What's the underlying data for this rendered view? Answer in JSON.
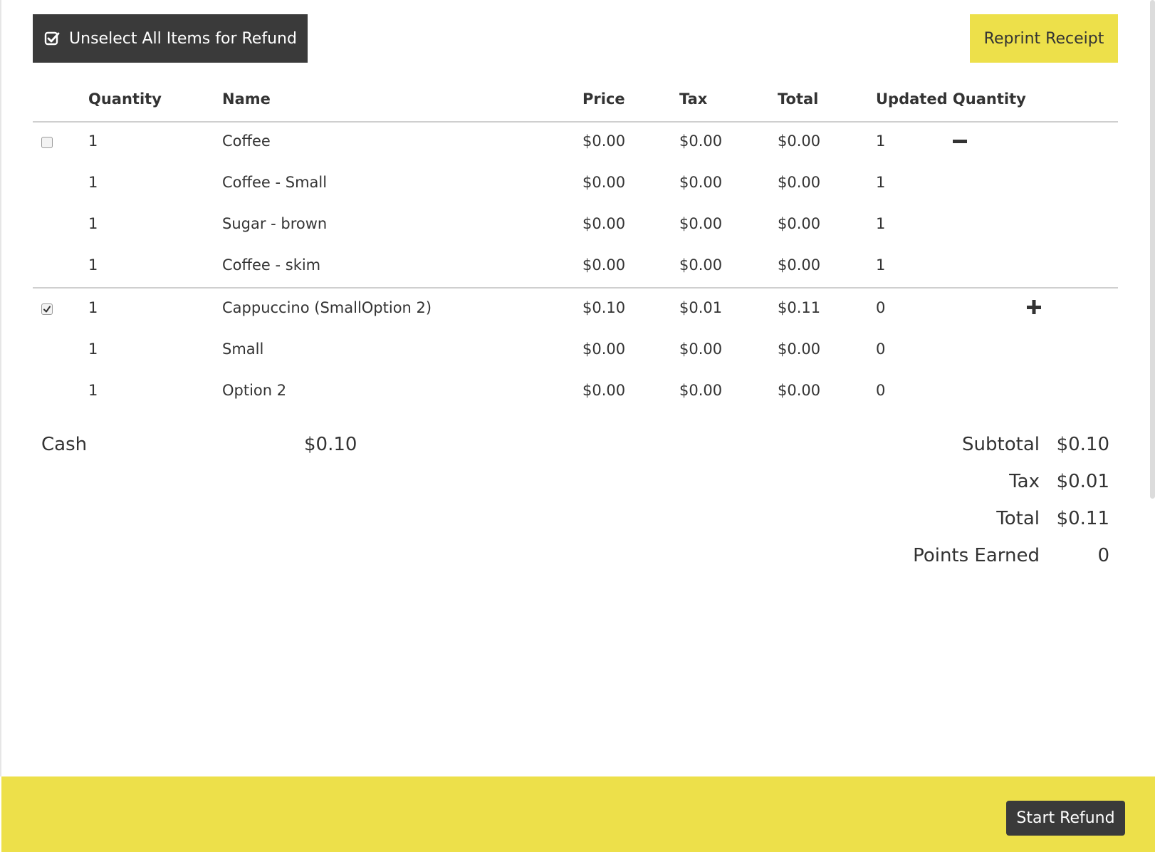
{
  "toolbar": {
    "unselect_all_label": "Unselect All Items for Refund",
    "reprint_label": "Reprint Receipt"
  },
  "table": {
    "headers": [
      "Quantity",
      "Name",
      "Price",
      "Tax",
      "Total",
      "Updated Quantity"
    ],
    "rows": [
      {
        "quantity": "1",
        "name": "Coffee",
        "price": "$0.00",
        "tax": "$0.00",
        "total": "$0.00",
        "updated_quantity": "1"
      },
      {
        "quantity": "1",
        "name": "Coffee - Small",
        "price": "$0.00",
        "tax": "$0.00",
        "total": "$0.00",
        "updated_quantity": "1"
      },
      {
        "quantity": "1",
        "name": "Sugar - brown",
        "price": "$0.00",
        "tax": "$0.00",
        "total": "$0.00",
        "updated_quantity": "1"
      },
      {
        "quantity": "1",
        "name": "Coffee - skim",
        "price": "$0.00",
        "tax": "$0.00",
        "total": "$0.00",
        "updated_quantity": "1"
      },
      {
        "quantity": "1",
        "name": "Cappuccino (SmallOption 2)",
        "price": "$0.10",
        "tax": "$0.01",
        "total": "$0.11",
        "updated_quantity": "0"
      },
      {
        "quantity": "1",
        "name": "Small",
        "price": "$0.00",
        "tax": "$0.00",
        "total": "$0.00",
        "updated_quantity": "0"
      },
      {
        "quantity": "1",
        "name": "Option 2",
        "price": "$0.00",
        "tax": "$0.00",
        "total": "$0.00",
        "updated_quantity": "0"
      }
    ],
    "groups": [
      {
        "checked": false,
        "control": "minus-icon"
      },
      {
        "checked": true,
        "control": "plus-icon"
      }
    ]
  },
  "payment": {
    "method": "Cash",
    "amount": "$0.10"
  },
  "summary": [
    {
      "label": "Subtotal",
      "value": "$0.10"
    },
    {
      "label": "Tax",
      "value": "$0.01"
    },
    {
      "label": "Total",
      "value": "$0.11"
    },
    {
      "label": "Points Earned",
      "value": "0"
    }
  ],
  "footer": {
    "start_refund_label": "Start Refund"
  },
  "colors": {
    "accent_yellow": "#ede04a",
    "dark_button": "#3a3a3a",
    "text": "#333333"
  }
}
